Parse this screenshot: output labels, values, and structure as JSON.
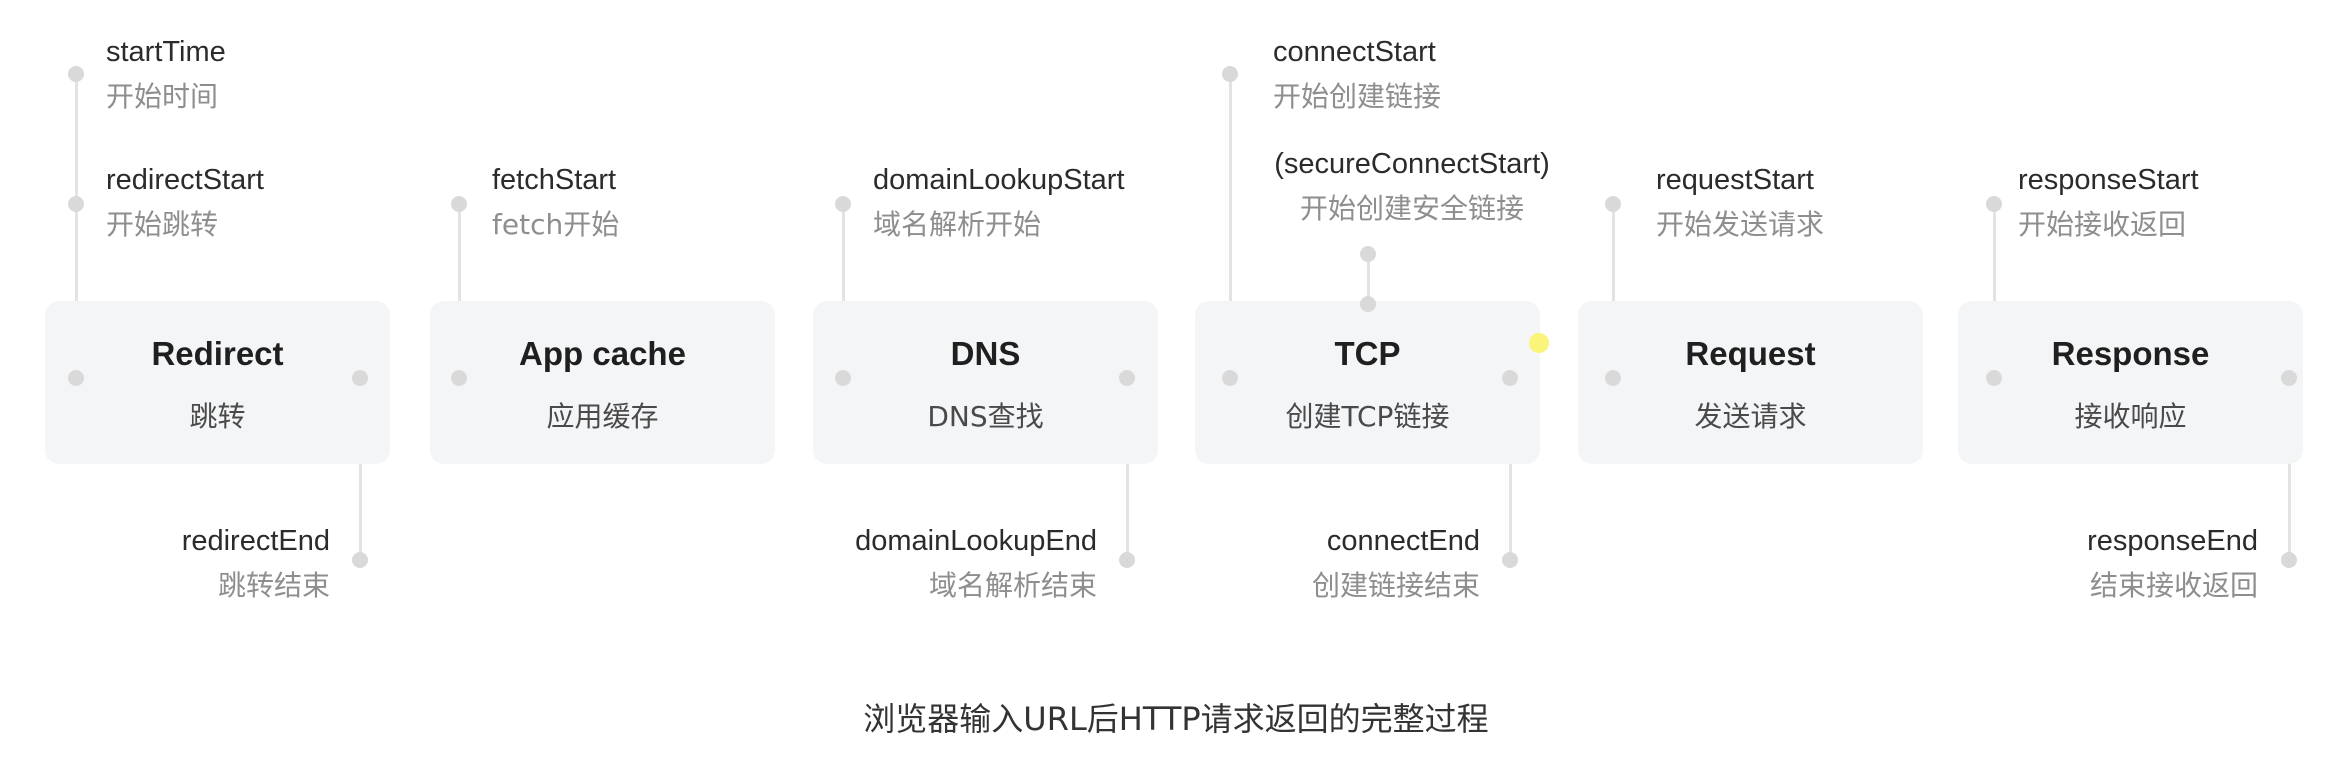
{
  "stages": [
    {
      "name": "Redirect",
      "sub": "跳转"
    },
    {
      "name": "App cache",
      "sub": "应用缓存"
    },
    {
      "name": "DNS",
      "sub": "DNS查找"
    },
    {
      "name": "TCP",
      "sub": "创建TCP链接"
    },
    {
      "name": "Request",
      "sub": "发送请求"
    },
    {
      "name": "Response",
      "sub": "接收响应"
    }
  ],
  "events": {
    "startTime": {
      "en": "startTime",
      "zh": "开始时间"
    },
    "redirectStart": {
      "en": "redirectStart",
      "zh": "开始跳转"
    },
    "redirectEnd": {
      "en": "redirectEnd",
      "zh": "跳转结束"
    },
    "fetchStart": {
      "en": "fetchStart",
      "zh": "fetch开始"
    },
    "domainLookupStart": {
      "en": "domainLookupStart",
      "zh": "域名解析开始"
    },
    "domainLookupEnd": {
      "en": "domainLookupEnd",
      "zh": "域名解析结束"
    },
    "connectStart": {
      "en": "connectStart",
      "zh": "开始创建链接"
    },
    "secureConnectStart": {
      "en": "(secureConnectStart)",
      "zh": "开始创建安全链接"
    },
    "connectEnd": {
      "en": "connectEnd",
      "zh": "创建链接结束"
    },
    "requestStart": {
      "en": "requestStart",
      "zh": "开始发送请求"
    },
    "responseStart": {
      "en": "responseStart",
      "zh": "开始接收返回"
    },
    "responseEnd": {
      "en": "responseEnd",
      "zh": "结束接收返回"
    }
  },
  "caption": "浏览器输入URL后HTTP请求返回的完整过程",
  "colors": {
    "stage_bg": "#f4f5f7",
    "connector": "#e3e3e3",
    "dot": "#d9d9d9",
    "marker": "#fbf47a"
  }
}
